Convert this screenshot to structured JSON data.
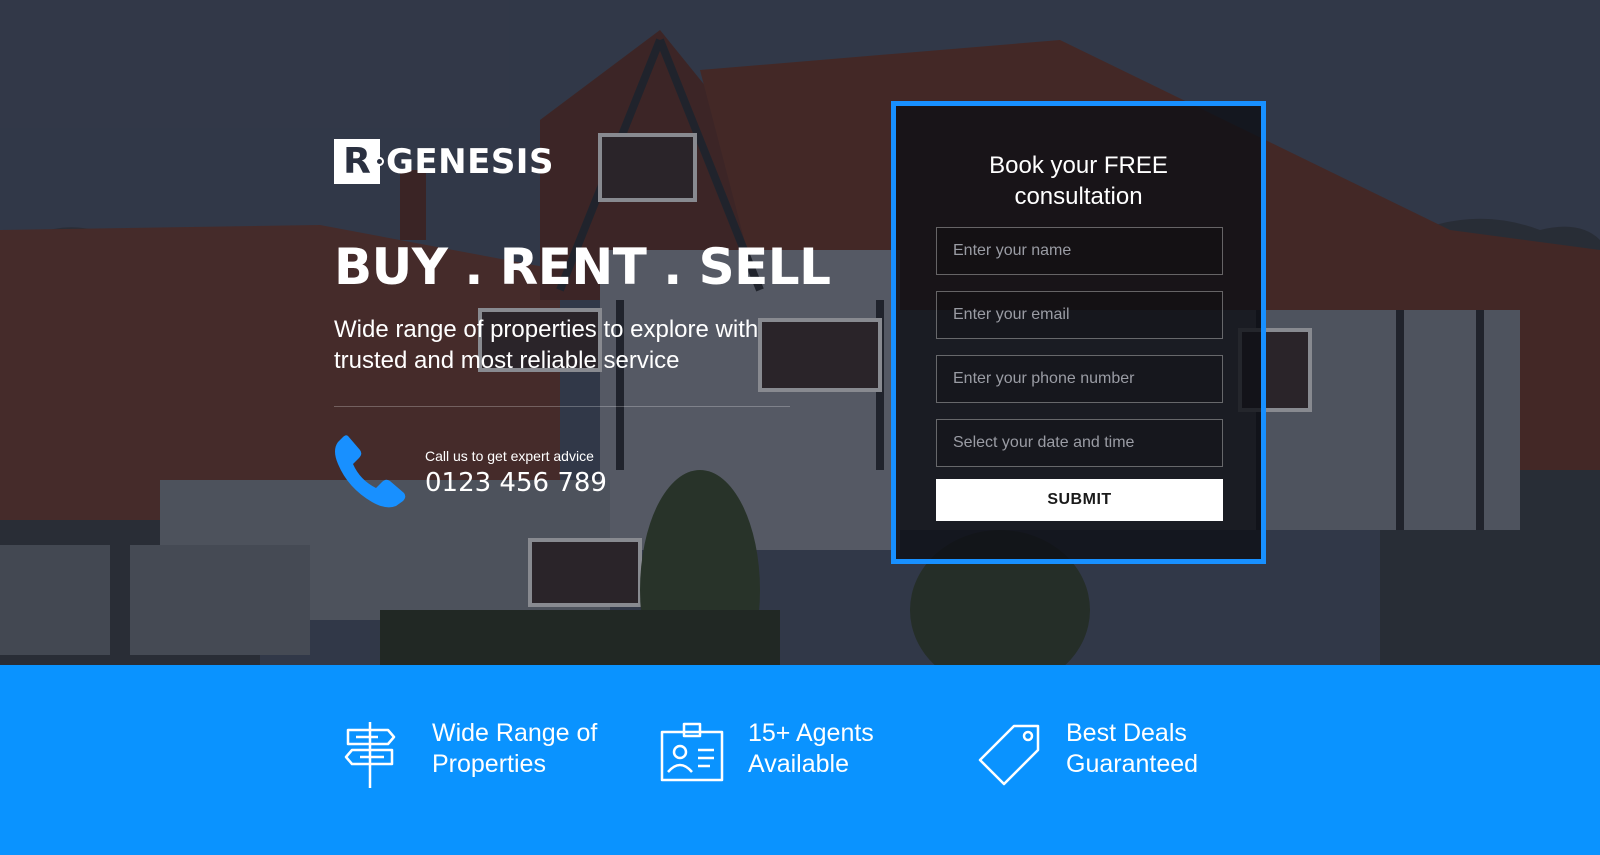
{
  "brand": {
    "mark": "R",
    "name": "GENESIS"
  },
  "hero": {
    "headline": "BUY . RENT . SELL",
    "subline": "Wide range of properties to explore with trusted and most reliable service",
    "call_label": "Call us to get expert advice",
    "call_number": "0123 456 789"
  },
  "form": {
    "title_line1": "Book your FREE",
    "title_line2": "consultation",
    "name_placeholder": "Enter your name",
    "email_placeholder": "Enter your email",
    "phone_placeholder": "Enter your phone number",
    "datetime_placeholder": "Select your date and time",
    "submit_label": "SUBMIT"
  },
  "features": [
    {
      "icon": "signpost-icon",
      "line1": "Wide Range of",
      "line2": "Properties"
    },
    {
      "icon": "agent-id-card-icon",
      "line1": "15+ Agents",
      "line2": "Available"
    },
    {
      "icon": "price-tag-icon",
      "line1": "Best Deals",
      "line2": "Guaranteed"
    }
  ],
  "colors": {
    "accent": "#1890ff",
    "band": "#0a93ff",
    "card": "#0f1016"
  }
}
